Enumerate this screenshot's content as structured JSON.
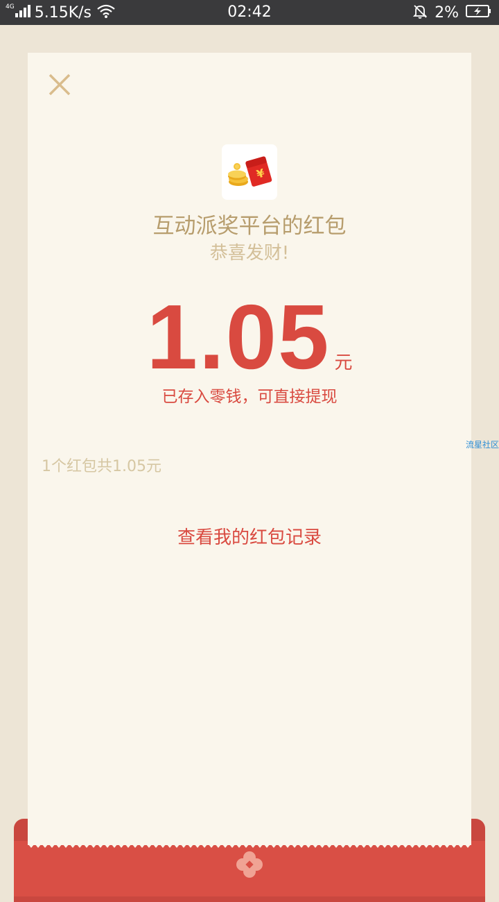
{
  "status_bar": {
    "network_type": "4G",
    "network_speed": "5.15K/s",
    "time": "02:42",
    "battery_percent": "2%",
    "icons": [
      "signal-icon",
      "wifi-icon",
      "bell-muted-icon",
      "battery-charging-icon"
    ]
  },
  "red_packet": {
    "sender_name": "互动派奖平台的红包",
    "greeting": "恭喜发财!",
    "amount": "1.05",
    "unit": "元",
    "deposit_note": "已存入零钱，可直接提现",
    "summary": "1个红包共1.05元",
    "history_link": "查看我的红包记录"
  },
  "watermark": "流星社区",
  "icons": [
    "close-icon",
    "red-packet-logo-icon",
    "seal-icon"
  ],
  "colors": {
    "background": "#ede5d6",
    "card": "#faf6ec",
    "status_bar": "#3a3a3c",
    "accent_red": "#d94a40",
    "gold_text": "#b79d6d",
    "light_gold_text": "#d3bf98"
  }
}
